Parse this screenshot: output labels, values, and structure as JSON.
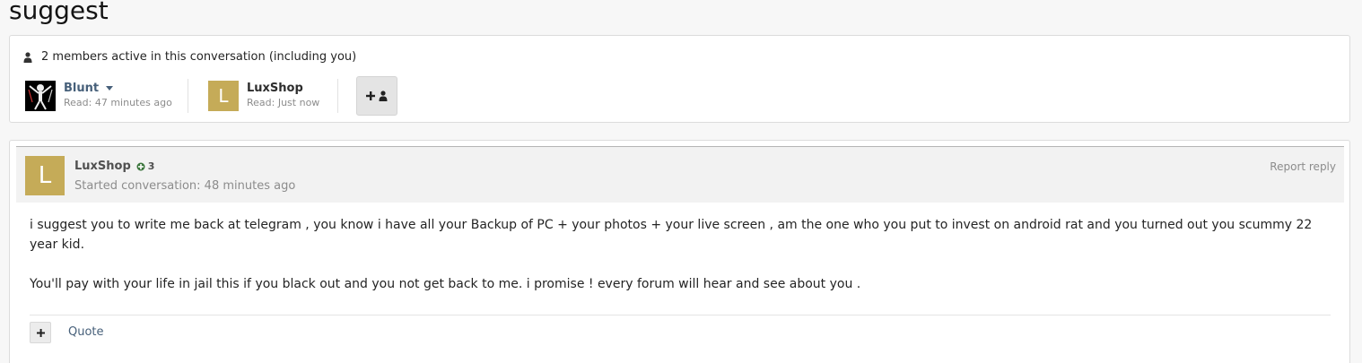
{
  "page": {
    "title": "suggest"
  },
  "members": {
    "header": "2 members active in this conversation (including you)",
    "list": [
      {
        "name": "Blunt",
        "read": "Read: 47 minutes ago"
      },
      {
        "name": "LuxShop",
        "initial": "L",
        "read": "Read: Just now"
      }
    ]
  },
  "message": {
    "author": "LuxShop",
    "avatar_initial": "L",
    "reputation": "3",
    "meta": "Started conversation: 48 minutes ago",
    "report_label": "Report reply",
    "body": [
      "i suggest you to write me back at telegram , you know i have all your Backup of PC  + your photos + your live screen , am the one who you put to invest on android rat and you turned out you scummy 22 year kid.",
      "You'll pay with your life in jail this if you black out and you not get back to me. i promise ! every forum will hear and see about you ."
    ],
    "quote_label": "Quote"
  },
  "colors": {
    "avatar_gold": "#c5ab58",
    "link": "#47607a",
    "reputation_green": "#3c763d"
  }
}
